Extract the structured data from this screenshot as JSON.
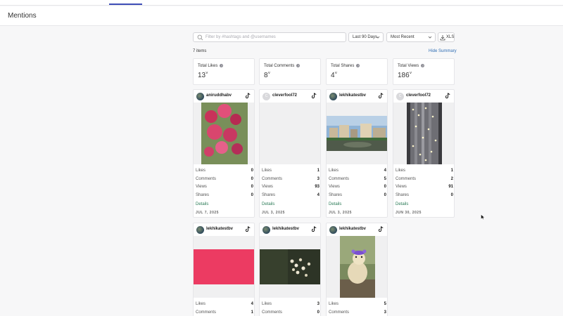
{
  "page": {
    "title": "Mentions"
  },
  "search": {
    "placeholder": "Filter by #hashtags and @usernames"
  },
  "filters": {
    "date_range": "Last 90 Days",
    "sort": "Most Recent",
    "export_label": "XLS"
  },
  "list": {
    "count_label": "7 items",
    "hide_summary_label": "Hide Summary"
  },
  "summary": [
    {
      "label": "Total Likes",
      "value": "13"
    },
    {
      "label": "Total Comments",
      "value": "8"
    },
    {
      "label": "Total Shares",
      "value": "4"
    },
    {
      "label": "Total Views",
      "value": "186"
    }
  ],
  "stat_labels": {
    "likes": "Likes",
    "comments": "Comments",
    "views": "Views",
    "shares": "Shares",
    "details": "Details"
  },
  "cards": [
    {
      "user": "aniruddhabv",
      "avatar": "photo",
      "likes": "0",
      "comments": "0",
      "views": "0",
      "shares": "0",
      "date": "JUL 7, 2025"
    },
    {
      "user": "cleverfool72",
      "avatar": "default",
      "avatar_letter": "C",
      "likes": "1",
      "comments": "3",
      "views": "93",
      "shares": "4",
      "date": "JUL 3, 2025"
    },
    {
      "user": "lekhikatestbv",
      "avatar": "photo",
      "likes": "4",
      "comments": "5",
      "views": "0",
      "shares": "0",
      "date": "JUL 3, 2025"
    },
    {
      "user": "cleverfool72",
      "avatar": "default",
      "avatar_letter": "C",
      "likes": "1",
      "comments": "2",
      "views": "91",
      "shares": "0",
      "date": "JUN 30, 2025"
    },
    {
      "user": "lekhikatestbv",
      "avatar": "photo",
      "likes": "4",
      "comments": "1"
    },
    {
      "user": "lekhikatestbv",
      "avatar": "photo",
      "likes": "3",
      "comments": "0"
    },
    {
      "user": "lekhikatestbv",
      "avatar": "photo",
      "likes": "5",
      "comments": "3"
    }
  ],
  "colors": {
    "accent": "#3d4db7",
    "link": "#2f6db3",
    "details": "#2a7a56"
  }
}
